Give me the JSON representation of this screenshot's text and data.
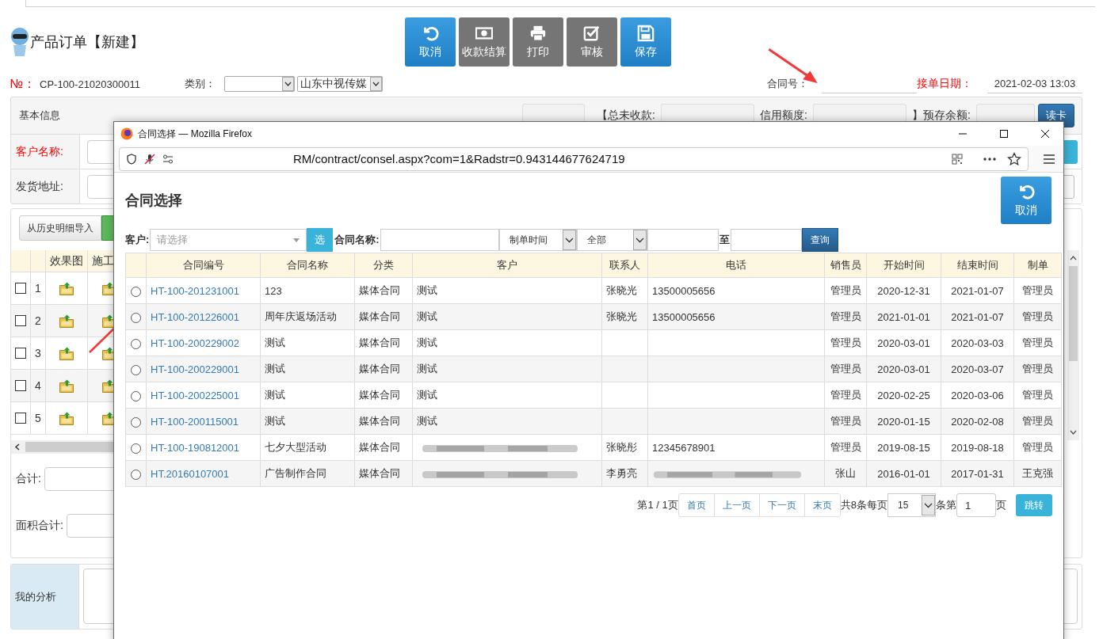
{
  "page": {
    "title": "产品订单【新建】",
    "toolbar": [
      {
        "label": "取消",
        "kind": "undo",
        "primary": true
      },
      {
        "label": "收款结算",
        "kind": "money",
        "primary": false
      },
      {
        "label": "打印",
        "kind": "print",
        "primary": false
      },
      {
        "label": "审核",
        "kind": "check",
        "primary": false
      },
      {
        "label": "保存",
        "kind": "save",
        "primary": true
      }
    ]
  },
  "order": {
    "no_label": "№：",
    "no": "CP-100-21020300011",
    "category_label": "类别：",
    "company": "山东中视传媒",
    "contract_label": "合同号：",
    "date_label": "接单日期：",
    "date": "2021-02-03 13:03"
  },
  "basic": {
    "title": "基本信息",
    "unpaid_label": "【总未收款:",
    "credit_label": "信用额度:",
    "prepaid_label": "】预存余额:",
    "read_card_button": "读卡",
    "customer_label": "客户名称:",
    "address_label": "发货地址:"
  },
  "details": {
    "import_button": "从历史明细导入",
    "columns": [
      "效果图",
      "施工"
    ],
    "rows": [
      {
        "no": "1",
        "checked": false
      },
      {
        "no": "2",
        "checked": false
      },
      {
        "no": "3",
        "checked": false
      },
      {
        "no": "4",
        "checked": false
      },
      {
        "no": "5",
        "checked": false
      }
    ],
    "total_label": "合计:",
    "area_total_label": "面积合计:"
  },
  "analysis": {
    "label": "我的分析"
  },
  "popup": {
    "window_title": "合同选择 — Mozilla Firefox",
    "url": "RM/contract/consel.aspx?com=1&Radstr=0.943144677624719",
    "heading": "合同选择",
    "cancel_button": "取消",
    "filter": {
      "customer_label": "客户:",
      "customer_placeholder": "请选择",
      "pick_button": "选",
      "name_label": "合同名称:",
      "time_type": "制单时间",
      "scope": "全部",
      "to_label": "至",
      "query_button": "查询"
    },
    "columns": [
      "合同编号",
      "合同名称",
      "分类",
      "客户",
      "联系人",
      "电话",
      "销售员",
      "开始时间",
      "结束时间",
      "制单"
    ],
    "rows": [
      {
        "selected": false,
        "contract_no": "HT-100-201231001",
        "name": "123",
        "category": "媒体合同",
        "customer": "测试",
        "contact": "张晓光",
        "phone": "13500005656",
        "salesperson": "管理员",
        "start": "2020-12-31",
        "end": "2021-01-07",
        "creator": "管理员"
      },
      {
        "selected": false,
        "contract_no": "HT-100-201226001",
        "name": "周年庆返场活动",
        "category": "媒体合同",
        "customer": "测试",
        "contact": "张晓光",
        "phone": "13500005656",
        "salesperson": "管理员",
        "start": "2021-01-01",
        "end": "2021-01-07",
        "creator": "管理员"
      },
      {
        "selected": false,
        "contract_no": "HT-100-200229002",
        "name": "测试",
        "category": "媒体合同",
        "customer": "测试",
        "salesperson": "管理员",
        "start": "2020-03-01",
        "end": "2020-03-03",
        "creator": "管理员"
      },
      {
        "selected": false,
        "contract_no": "HT-100-200229001",
        "name": "测试",
        "category": "媒体合同",
        "customer": "测试",
        "salesperson": "管理员",
        "start": "2020-03-01",
        "end": "2020-03-07",
        "creator": "管理员"
      },
      {
        "selected": false,
        "contract_no": "HT-100-200225001",
        "name": "测试",
        "category": "媒体合同",
        "customer": "测试",
        "salesperson": "管理员",
        "start": "2020-02-25",
        "end": "2020-03-06",
        "creator": "管理员"
      },
      {
        "selected": false,
        "contract_no": "HT-100-200115001",
        "name": "测试",
        "category": "媒体合同",
        "customer": "测试",
        "salesperson": "管理员",
        "start": "2020-01-15",
        "end": "2020-02-08",
        "creator": "管理员"
      },
      {
        "selected": false,
        "contract_no": "HT-100-190812001",
        "name": "七夕大型活动",
        "category": "媒体合同",
        "customer_blurred": true,
        "contact": "张晓彤",
        "phone": "12345678901",
        "salesperson": "管理员",
        "start": "2019-08-15",
        "end": "2019-08-18",
        "creator": "管理员"
      },
      {
        "selected": false,
        "contract_no": "HT.20160107001",
        "name": "广告制作合同",
        "category": "媒体合同",
        "customer_blurred": true,
        "contact": "李勇亮",
        "phone_blurred": true,
        "salesperson": "张山",
        "start": "2016-01-01",
        "end": "2017-01-31",
        "creator": "王克强"
      }
    ],
    "pager": {
      "page_info": "第1 / 1页",
      "buttons": [
        "首页",
        "上一页",
        "下一页",
        "末页"
      ],
      "total": "共8条每页",
      "page_size": "15",
      "per_label": "条第",
      "page": "1",
      "page_suffix": "页",
      "jump_button": "跳转"
    }
  }
}
